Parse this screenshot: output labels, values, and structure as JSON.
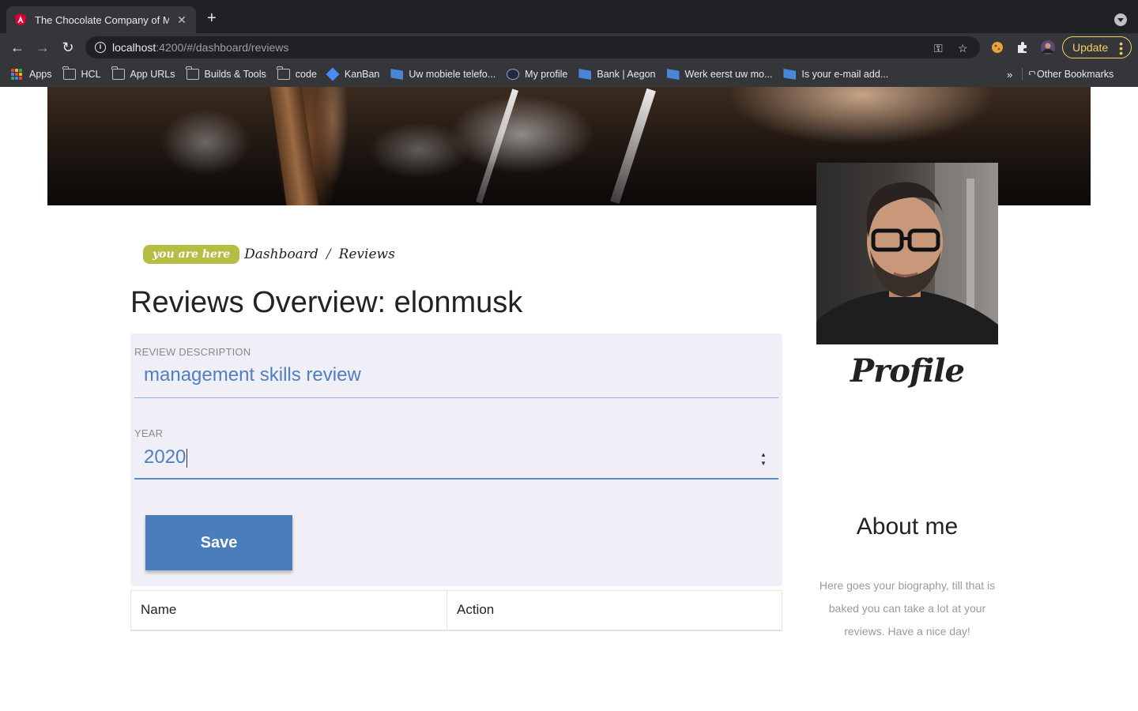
{
  "browser": {
    "tab_title": "The Chocolate Company of Ma",
    "tab_close": "✕",
    "new_tab": "+",
    "url_host": "localhost",
    "url_path": ":4200/#/dashboard/reviews",
    "update_label": "Update",
    "bookmarks": [
      {
        "label": "Apps",
        "icon": "apps-icon"
      },
      {
        "label": "HCL",
        "icon": "folder-icon"
      },
      {
        "label": "App URLs",
        "icon": "folder-icon"
      },
      {
        "label": "Builds & Tools",
        "icon": "folder-icon"
      },
      {
        "label": "code",
        "icon": "folder-icon"
      },
      {
        "label": "KanBan",
        "icon": "jira-icon"
      },
      {
        "label": "Uw mobiele telefo...",
        "icon": "bank-flag-icon"
      },
      {
        "label": "My profile",
        "icon": "profile-icon"
      },
      {
        "label": "Bank | Aegon",
        "icon": "bank-flag-icon"
      },
      {
        "label": "Werk eerst uw mo...",
        "icon": "bank-flag-icon"
      },
      {
        "label": "Is your e-mail add...",
        "icon": "bank-flag-icon"
      }
    ],
    "bookmarks_more": "»",
    "other_bookmarks": "Other Bookmarks"
  },
  "breadcrumb": {
    "badge": "you are here",
    "items": [
      "Dashboard",
      "Reviews"
    ],
    "separator": "/"
  },
  "page": {
    "title": "Reviews Overview: elonmusk"
  },
  "form": {
    "description_label": "REVIEW DESCRIPTION",
    "description_value": "management skills review",
    "year_label": "YEAR",
    "year_value": "2020",
    "save_label": "Save"
  },
  "table": {
    "headers": [
      "Name",
      "Action"
    ]
  },
  "sidebar": {
    "profile_heading": "Profile",
    "about_heading": "About me",
    "about_text": "Here goes your biography, till that is baked you can take a lot at your reviews. Have a nice day!"
  },
  "colors": {
    "accent_badge": "#b5bd45",
    "button": "#4a7dbb",
    "input_text": "#4f7fbf",
    "card_bg": "#f0eff7"
  }
}
